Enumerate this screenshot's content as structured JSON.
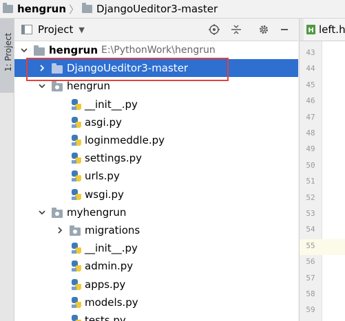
{
  "nav": {
    "project": "hengrun",
    "folder": "DjangoUeditor3-master",
    "separator": "〉"
  },
  "left_strip": {
    "tab_label": "1: Project"
  },
  "panel": {
    "title": "Project",
    "caret": "▼",
    "icons": [
      "crosshair-icon",
      "collapse-all-icon",
      "gear-icon",
      "minimize-icon"
    ]
  },
  "tree": [
    {
      "label": "hengrun",
      "hint": "E:\\PythonWork\\hengrun",
      "icon": "folder",
      "expanded": true,
      "bold": true
    },
    {
      "label": "DjangoUeditor3-master",
      "icon": "folder",
      "expanded": false,
      "selected": true
    },
    {
      "label": "hengrun",
      "icon": "package",
      "expanded": true
    },
    {
      "label": "__init__.py",
      "icon": "python"
    },
    {
      "label": "asgi.py",
      "icon": "python"
    },
    {
      "label": "loginmeddle.py",
      "icon": "python"
    },
    {
      "label": "settings.py",
      "icon": "python"
    },
    {
      "label": "urls.py",
      "icon": "python"
    },
    {
      "label": "wsgi.py",
      "icon": "python"
    },
    {
      "label": "myhengrun",
      "icon": "package",
      "expanded": true
    },
    {
      "label": "migrations",
      "icon": "package",
      "expanded": false
    },
    {
      "label": "__init__.py",
      "icon": "python"
    },
    {
      "label": "admin.py",
      "icon": "python"
    },
    {
      "label": "apps.py",
      "icon": "python"
    },
    {
      "label": "models.py",
      "icon": "python"
    },
    {
      "label": "tests.py",
      "icon": "python"
    }
  ],
  "editor": {
    "tab_label": "left.h",
    "tab_badge": "H",
    "current_line": 55,
    "line_numbers": [
      "43",
      "44",
      "45",
      "46",
      "47",
      "48",
      "49",
      "50",
      "51",
      "52",
      "53",
      "54",
      "55",
      "56",
      "57",
      "58",
      "59"
    ]
  },
  "colors": {
    "selection": "#2e6fd0",
    "highlight_box": "#e3403a",
    "python_blue": "#3e7ab8",
    "python_yellow": "#f1c83a"
  }
}
